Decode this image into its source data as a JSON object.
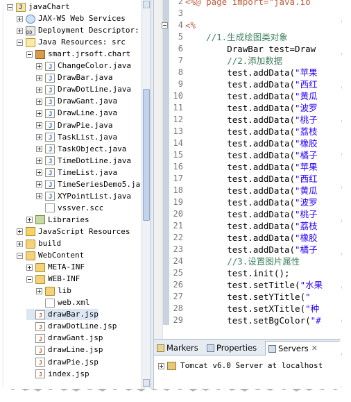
{
  "tree": {
    "items": [
      {
        "label": "javaChart",
        "icon": "project-icon",
        "toggle": "minus"
      },
      {
        "label": "JAX-WS Web Services",
        "icon": "jaxws-icon",
        "toggle": "plus"
      },
      {
        "label": "Deployment Descriptor: j",
        "icon": "deployment-icon",
        "toggle": "plus"
      },
      {
        "label": "Java Resources: src",
        "icon": "source-folder-icon",
        "toggle": "minus"
      },
      {
        "label": "smart.jrsoft.chart",
        "icon": "package-icon",
        "toggle": "minus"
      },
      {
        "label": "ChangeColor.java",
        "icon": "java-file-icon",
        "toggle": "plus"
      },
      {
        "label": "DrawBar.java",
        "icon": "java-file-icon",
        "toggle": "plus"
      },
      {
        "label": "DrawDotLine.java",
        "icon": "java-file-icon",
        "toggle": "plus"
      },
      {
        "label": "DrawGant.java",
        "icon": "java-file-icon",
        "toggle": "plus"
      },
      {
        "label": "DrawLine.java",
        "icon": "java-file-icon",
        "toggle": "plus"
      },
      {
        "label": "DrawPie.java",
        "icon": "java-file-icon",
        "toggle": "plus"
      },
      {
        "label": "TaskList.java",
        "icon": "java-file-icon",
        "toggle": "plus"
      },
      {
        "label": "TaskObject.java",
        "icon": "java-file-icon",
        "toggle": "plus"
      },
      {
        "label": "TimeDotLine.java",
        "icon": "java-file-icon",
        "toggle": "plus"
      },
      {
        "label": "TimeList.java",
        "icon": "java-file-icon",
        "toggle": "plus"
      },
      {
        "label": "TimeSeriesDemo5.ja",
        "icon": "java-file-icon",
        "toggle": "plus"
      },
      {
        "label": "XYPointList.java",
        "icon": "java-file-icon",
        "toggle": "plus"
      },
      {
        "label": "vssver.scc",
        "icon": "file-icon",
        "toggle": "none"
      },
      {
        "label": "Libraries",
        "icon": "library-icon",
        "toggle": "plus"
      },
      {
        "label": "JavaScript Resources",
        "icon": "javascript-icon",
        "toggle": "plus"
      },
      {
        "label": "build",
        "icon": "folder-icon",
        "toggle": "plus"
      },
      {
        "label": "WebContent",
        "icon": "folder-icon",
        "toggle": "minus"
      },
      {
        "label": "META-INF",
        "icon": "folder-icon",
        "toggle": "plus"
      },
      {
        "label": "WEB-INF",
        "icon": "folder-icon",
        "toggle": "minus"
      },
      {
        "label": "lib",
        "icon": "folder-icon",
        "toggle": "plus"
      },
      {
        "label": "web.xml",
        "icon": "xml-file-icon",
        "toggle": "none"
      },
      {
        "label": "drawBar.jsp",
        "icon": "jsp-file-icon",
        "toggle": "none"
      },
      {
        "label": "drawDotLine.jsp",
        "icon": "jsp-file-icon",
        "toggle": "none"
      },
      {
        "label": "drawGant.jsp",
        "icon": "jsp-file-icon",
        "toggle": "none"
      },
      {
        "label": "drawLine.jsp",
        "icon": "jsp-file-icon",
        "toggle": "none"
      },
      {
        "label": "drawPie.jsp",
        "icon": "jsp-file-icon",
        "toggle": "none"
      },
      {
        "label": "index.jsp",
        "icon": "jsp-file-icon",
        "toggle": "none"
      }
    ]
  },
  "editor": {
    "lines": [
      {
        "no": "2",
        "text": "<%@ page import=\"java.io"
      },
      {
        "no": "3",
        "text": ""
      },
      {
        "no": "4",
        "text": "<%"
      },
      {
        "no": "5",
        "text": "    //1.生成绘图类对象"
      },
      {
        "no": "6",
        "text": "        DrawBar test=Draw"
      },
      {
        "no": "7",
        "text": "        //2.添加数据"
      },
      {
        "no": "8",
        "text": "        test.addData(\"苹果"
      },
      {
        "no": "9",
        "text": "        test.addData(\"西红"
      },
      {
        "no": "10",
        "text": "        test.addData(\"黄瓜"
      },
      {
        "no": "11",
        "text": "        test.addData(\"波罗"
      },
      {
        "no": "12",
        "text": "        test.addData(\"桃子"
      },
      {
        "no": "13",
        "text": "        test.addData(\"荔枝"
      },
      {
        "no": "14",
        "text": "        test.addData(\"橡胶"
      },
      {
        "no": "15",
        "text": "        test.addData(\"橘子"
      },
      {
        "no": "16",
        "text": "        test.addData(\"苹果"
      },
      {
        "no": "17",
        "text": "        test.addData(\"西红"
      },
      {
        "no": "18",
        "text": "        test.addData(\"黄瓜"
      },
      {
        "no": "19",
        "text": "        test.addData(\"波罗"
      },
      {
        "no": "20",
        "text": "        test.addData(\"桃子"
      },
      {
        "no": "21",
        "text": "        test.addData(\"荔枝"
      },
      {
        "no": "22",
        "text": "        test.addData(\"橡胶"
      },
      {
        "no": "23",
        "text": "        test.addData(\"橘子"
      },
      {
        "no": "24",
        "text": "        //3.设置图片属性"
      },
      {
        "no": "25",
        "text": "        test.init();"
      },
      {
        "no": "26",
        "text": "        test.setTitle(\"水果"
      },
      {
        "no": "27",
        "text": "        test.setYTitle(\""
      },
      {
        "no": "28",
        "text": "        test.setXTitle(\"种"
      },
      {
        "no": "29",
        "text": "        test.setBgColor(\"#"
      }
    ]
  },
  "bottom_panel": {
    "tabs": [
      {
        "label": "Markers"
      },
      {
        "label": "Properties"
      },
      {
        "label": "Servers",
        "active": true
      }
    ],
    "server": "Tomcat v6.0 Server at localhost"
  },
  "colors": {
    "comment": "#3f7f5f",
    "string": "#2a00ff",
    "jsp_tag": "#bf5f3f",
    "selection": "#dde7f3"
  }
}
